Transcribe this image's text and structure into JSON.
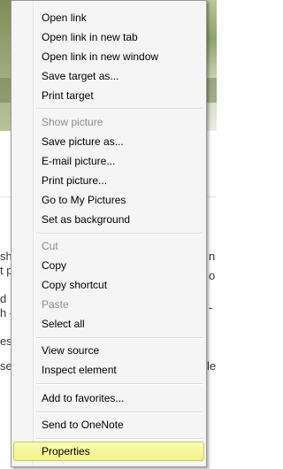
{
  "menu": {
    "groups": [
      [
        {
          "label": "Open link",
          "disabled": false
        },
        {
          "label": "Open link in new tab",
          "disabled": false
        },
        {
          "label": "Open link in new window",
          "disabled": false
        },
        {
          "label": "Save target as...",
          "disabled": false
        },
        {
          "label": "Print target",
          "disabled": false
        }
      ],
      [
        {
          "label": "Show picture",
          "disabled": true
        },
        {
          "label": "Save picture as...",
          "disabled": false
        },
        {
          "label": "E-mail picture...",
          "disabled": false
        },
        {
          "label": "Print picture...",
          "disabled": false
        },
        {
          "label": "Go to My Pictures",
          "disabled": false
        },
        {
          "label": "Set as background",
          "disabled": false
        }
      ],
      [
        {
          "label": "Cut",
          "disabled": true
        },
        {
          "label": "Copy",
          "disabled": false
        },
        {
          "label": "Copy shortcut",
          "disabled": false
        },
        {
          "label": "Paste",
          "disabled": true
        },
        {
          "label": "Select all",
          "disabled": false
        }
      ],
      [
        {
          "label": "View source",
          "disabled": false
        },
        {
          "label": "Inspect element",
          "disabled": false
        }
      ],
      [
        {
          "label": "Add to favorites...",
          "disabled": false
        }
      ],
      [
        {
          "label": "Send to OneNote",
          "disabled": false
        }
      ],
      [
        {
          "label": "Properties",
          "disabled": false,
          "highlighted": true
        }
      ]
    ],
    "highlight_color": "#f3f590"
  },
  "background": {
    "left_fragments": [
      "sh",
      "t p",
      "d",
      "h –",
      "es",
      "se"
    ],
    "right_fragments": [
      "n",
      "o",
      "-",
      "le"
    ]
  }
}
